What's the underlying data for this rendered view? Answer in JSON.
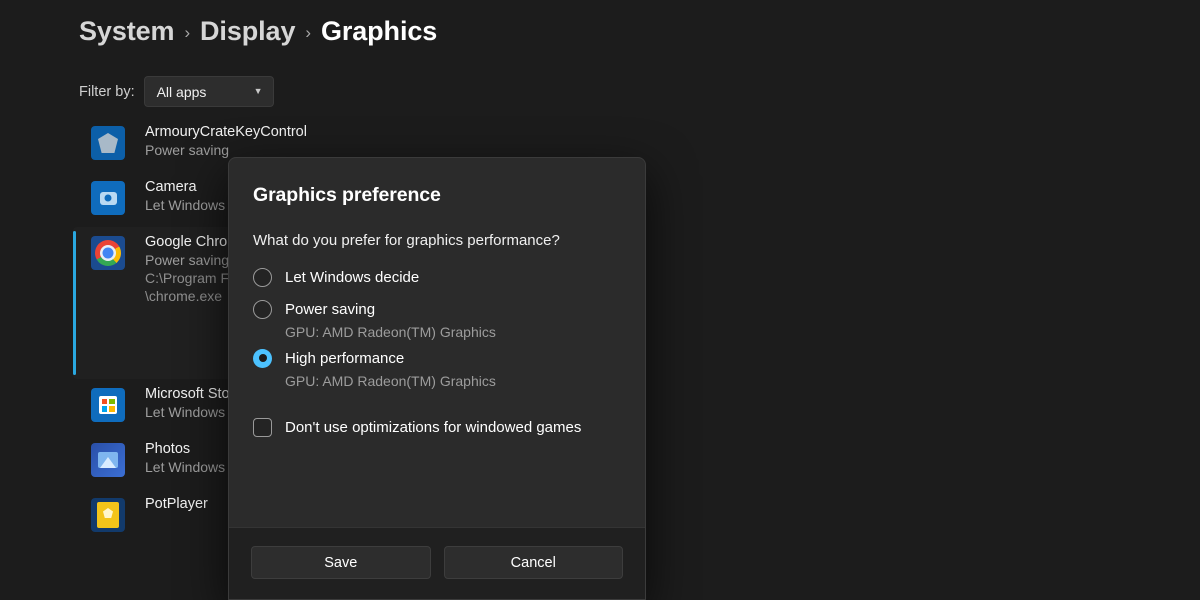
{
  "breadcrumb": {
    "items": [
      "System",
      "Display",
      "Graphics"
    ],
    "separator": "›"
  },
  "filter": {
    "label": "Filter by:",
    "selected": "All apps",
    "chevron": "chevron-down-icon"
  },
  "app_list": [
    {
      "name": "ArmouryCrateKeyControl",
      "preference": "Power saving",
      "path": "",
      "icon": "armoury-crate-icon",
      "expanded": false,
      "selected": false
    },
    {
      "name": "Camera",
      "preference": "Let Windows",
      "path": "",
      "icon": "camera-icon",
      "expanded": false,
      "selected": false
    },
    {
      "name": "Google Chrome",
      "preference": "Power saving",
      "path": "C:\\Program Files\\Google\\Chrome\\Application",
      "path_line2": "\\chrome.exe",
      "icon": "chrome-icon",
      "expanded": true,
      "selected": true
    },
    {
      "name": "Microsoft Store",
      "preference": "Let Windows",
      "path": "",
      "icon": "microsoft-store-icon",
      "expanded": false,
      "selected": false
    },
    {
      "name": "Photos",
      "preference": "Let Windows",
      "path": "",
      "icon": "photos-icon",
      "expanded": false,
      "selected": false
    },
    {
      "name": "PotPlayer",
      "preference": "",
      "path": "",
      "icon": "potplayer-icon",
      "expanded": false,
      "selected": false
    }
  ],
  "dialog": {
    "title": "Graphics preference",
    "question": "What do you prefer for graphics performance?",
    "options": [
      {
        "label": "Let Windows decide",
        "gpu": "",
        "checked": false
      },
      {
        "label": "Power saving",
        "gpu": "GPU: AMD Radeon(TM) Graphics",
        "checked": false
      },
      {
        "label": "High performance",
        "gpu": "GPU: AMD Radeon(TM) Graphics",
        "checked": true
      }
    ],
    "checkbox": {
      "label": "Don't use optimizations for windowed games",
      "checked": false
    },
    "buttons": {
      "save": "Save",
      "cancel": "Cancel"
    }
  },
  "colors": {
    "page_background": "#1c1c1c",
    "dialog_background": "#2b2b2b",
    "dialog_footer": "#202020",
    "accent": "#4cc2ff",
    "selection_bar": "#2aa8e0",
    "primary_text": "#ffffff",
    "secondary_text": "#9e9e9e"
  }
}
